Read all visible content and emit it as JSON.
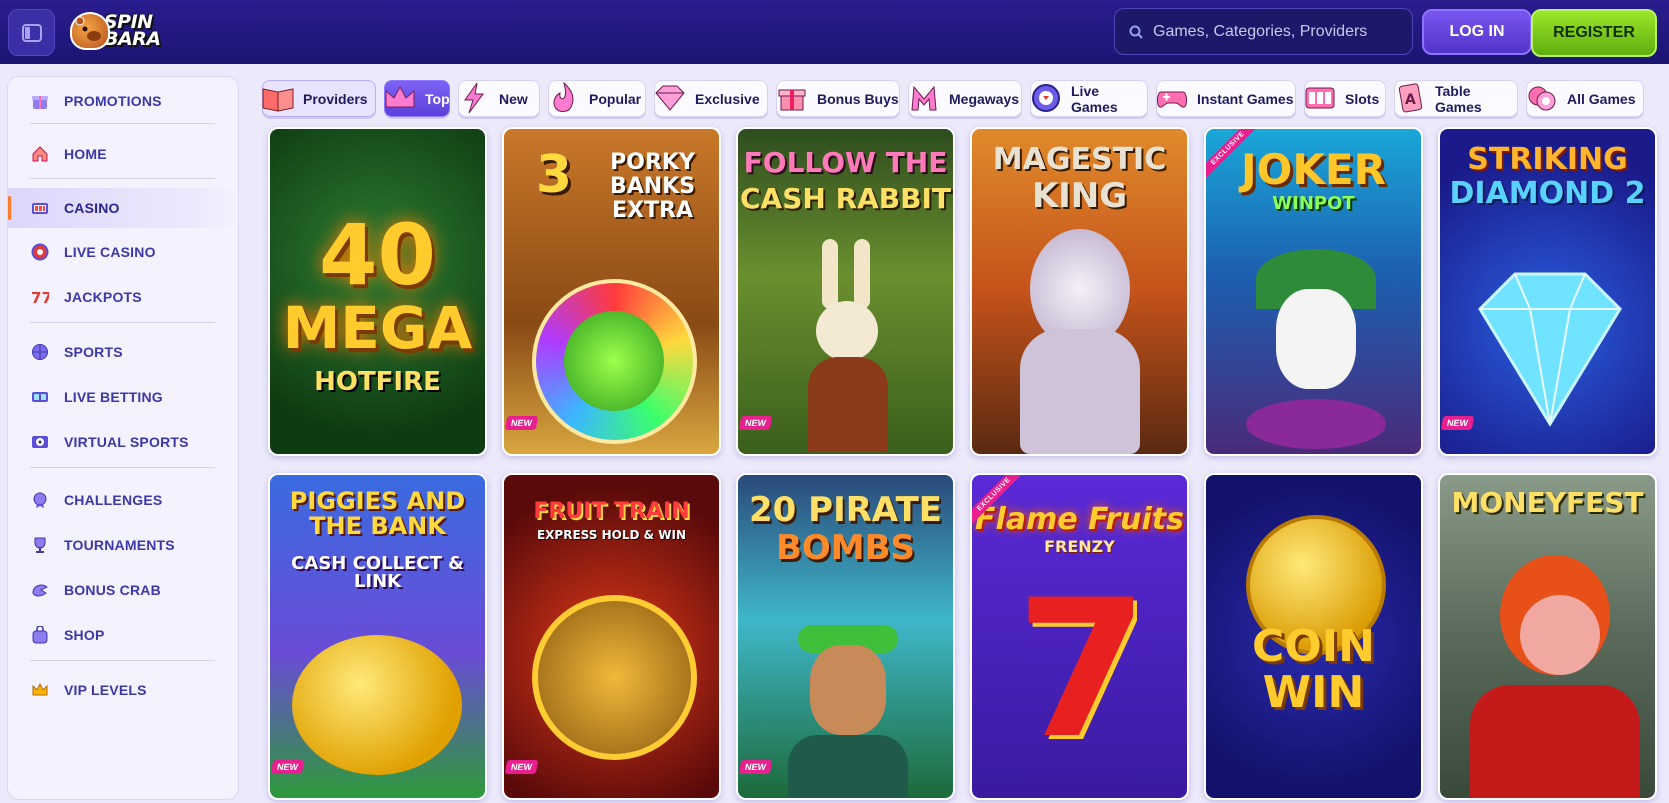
{
  "header": {
    "brand": "SPIN BARA",
    "brand_line1": "SPIN",
    "brand_line2": "BARA",
    "search_placeholder": "Games, Categories, Providers",
    "login_label": "LOG IN",
    "register_label": "REGISTER"
  },
  "sidebar": {
    "items": [
      {
        "label": "PROMOTIONS",
        "icon": "gift-icon"
      },
      {
        "label": "HOME",
        "icon": "house-icon"
      },
      {
        "label": "CASINO",
        "icon": "slot-machine-icon",
        "active": true
      },
      {
        "label": "LIVE CASINO",
        "icon": "poker-chip-icon"
      },
      {
        "label": "JACKPOTS",
        "icon": "seven-seven-icon"
      },
      {
        "label": "SPORTS",
        "icon": "basketball-icon"
      },
      {
        "label": "LIVE BETTING",
        "icon": "scoreboard-icon"
      },
      {
        "label": "VIRTUAL SPORTS",
        "icon": "virtual-ball-icon"
      },
      {
        "label": "CHALLENGES",
        "icon": "medal-icon"
      },
      {
        "label": "TOURNAMENTS",
        "icon": "trophy-icon"
      },
      {
        "label": "BONUS CRAB",
        "icon": "crab-claw-icon"
      },
      {
        "label": "SHOP",
        "icon": "shopping-bag-icon"
      },
      {
        "label": "VIP LEVELS",
        "icon": "crown-icon"
      }
    ]
  },
  "tabs": [
    {
      "label": "Providers",
      "icon": "book-icon"
    },
    {
      "label": "Top",
      "icon": "crown-icon"
    },
    {
      "label": "New",
      "icon": "lightning-icon"
    },
    {
      "label": "Popular",
      "icon": "flame-icon"
    },
    {
      "label": "Exclusive",
      "icon": "diamond-icon"
    },
    {
      "label": "Bonus Buys",
      "icon": "gift-box-icon"
    },
    {
      "label": "Megaways",
      "icon": "megaways-m-icon"
    },
    {
      "label": "Live Games",
      "icon": "roulette-icon"
    },
    {
      "label": "Instant Games",
      "icon": "gamepad-icon"
    },
    {
      "label": "Slots",
      "icon": "slot-reels-icon"
    },
    {
      "label": "Table Games",
      "icon": "playing-card-icon"
    },
    {
      "label": "All Games",
      "icon": "chips-icon"
    }
  ],
  "games": [
    {
      "title_lines": [
        "40",
        "MEGA",
        "HOTFIRE"
      ],
      "badge": ""
    },
    {
      "title_lines": [
        "3",
        "PORKY BANKS EXTRA"
      ],
      "badge": "NEW"
    },
    {
      "title_lines": [
        "FOLLOW THE",
        "CASH RABBIT"
      ],
      "badge": "NEW"
    },
    {
      "title_lines": [
        "MAGESTIC",
        "KING"
      ],
      "badge": ""
    },
    {
      "title_lines": [
        "JOKER",
        "WINPOT"
      ],
      "badge": "EXCLUSIVE"
    },
    {
      "title_lines": [
        "STRIKING",
        "DIAMOND 2"
      ],
      "badge": "NEW"
    },
    {
      "title_lines": [
        "PIGGIES AND THE BANK",
        "CASH COLLECT & LINK"
      ],
      "badge": "NEW"
    },
    {
      "title_lines": [
        "FRUIT TRAIN",
        "EXPRESS HOLD & WIN"
      ],
      "badge": "NEW"
    },
    {
      "title_lines": [
        "20 PIRATE",
        "BOMBS"
      ],
      "badge": "NEW"
    },
    {
      "title_lines": [
        "Flame Fruits",
        "FRENZY"
      ],
      "badge": "EXCLUSIVE"
    },
    {
      "title_lines": [
        "COIN",
        "WIN"
      ],
      "badge": ""
    },
    {
      "title_lines": [
        "MONEYFEST"
      ],
      "badge": ""
    }
  ],
  "colors": {
    "header_bg": "#1b1572",
    "accent_purple": "#5b41d9",
    "register_green": "#7cc81b",
    "nav_text": "#3d38a8",
    "active_marker": "#ff7a2b",
    "badge_pink": "#e8208f"
  }
}
